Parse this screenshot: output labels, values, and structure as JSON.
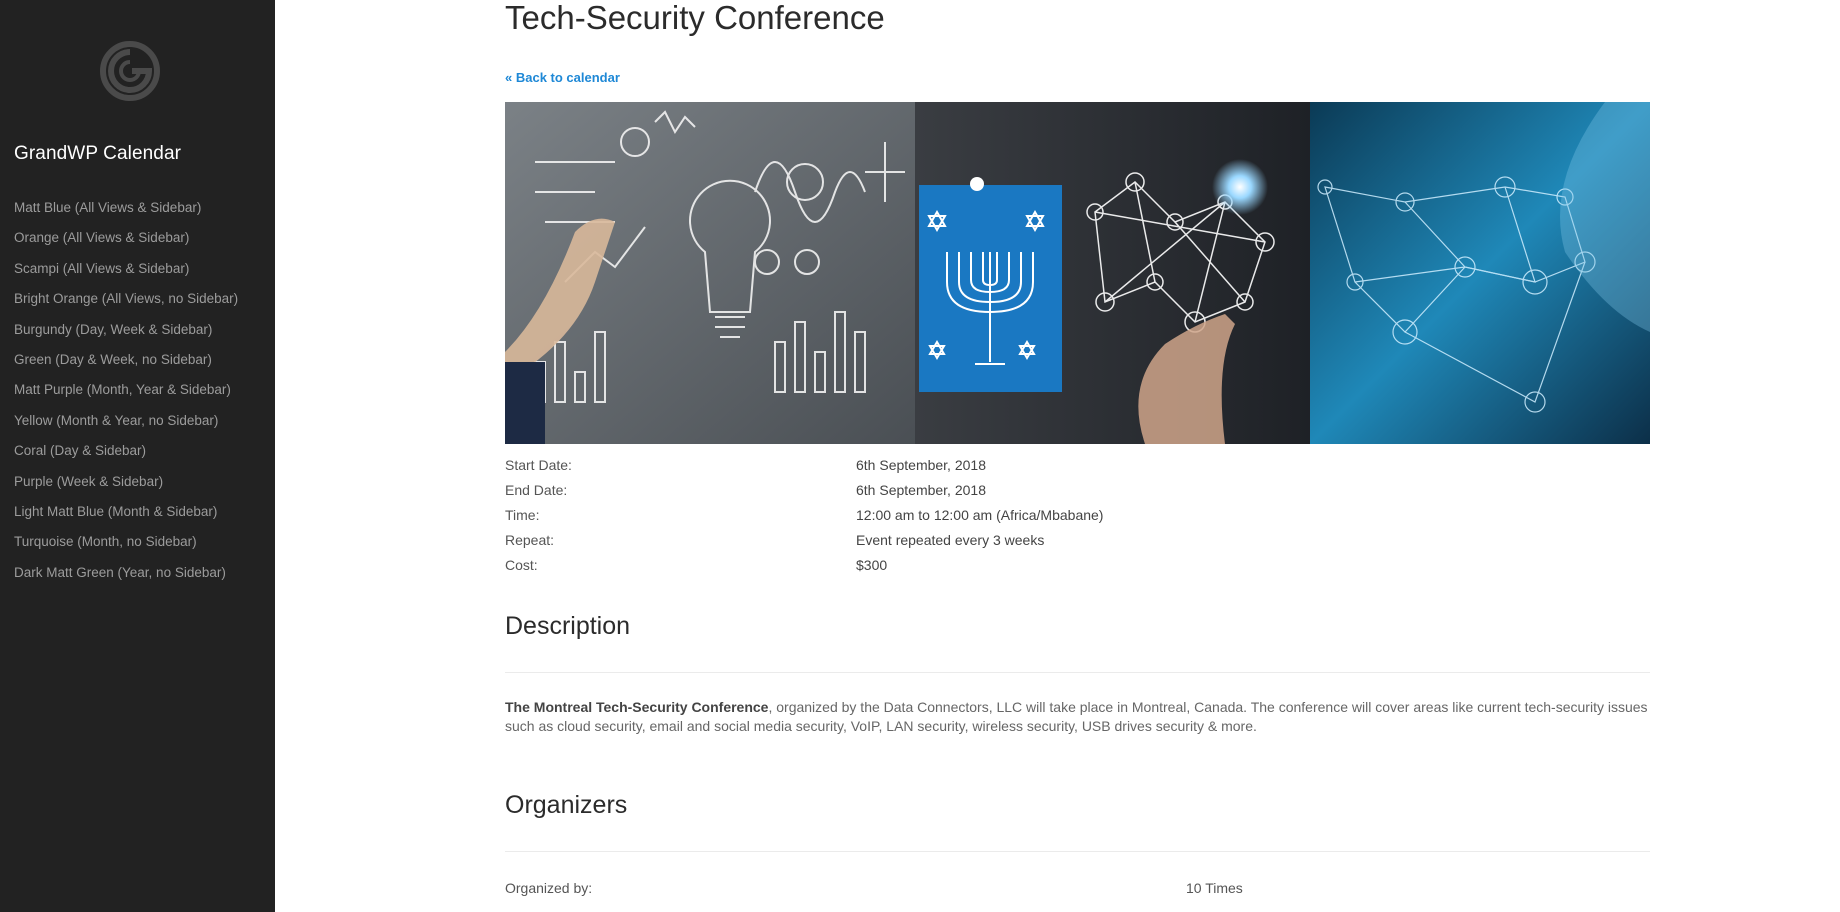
{
  "sidebar": {
    "brand": "GrandWP Calendar",
    "logo_icon": "grandwp-logo-icon",
    "items": [
      {
        "label": "Matt Blue (All Views & Sidebar)"
      },
      {
        "label": "Orange (All Views & Sidebar)"
      },
      {
        "label": "Scampi (All Views & Sidebar)"
      },
      {
        "label": "Bright Orange (All Views, no Sidebar)"
      },
      {
        "label": "Burgundy (Day, Week & Sidebar)"
      },
      {
        "label": "Green (Day & Week, no Sidebar)"
      },
      {
        "label": "Matt Purple (Month, Year & Sidebar)"
      },
      {
        "label": "Yellow (Month & Year, no Sidebar)"
      },
      {
        "label": "Coral (Day & Sidebar)"
      },
      {
        "label": "Purple (Week & Sidebar)"
      },
      {
        "label": "Light Matt Blue (Month & Sidebar)"
      },
      {
        "label": "Turquoise (Month, no Sidebar)"
      },
      {
        "label": "Dark Matt Green (Year, no Sidebar)"
      }
    ]
  },
  "event": {
    "title": "Tech-Security Conference",
    "back_link": "« Back to calendar",
    "details": [
      {
        "label": "Start Date:",
        "value": "6th September, 2018"
      },
      {
        "label": "End Date:",
        "value": "6th September, 2018"
      },
      {
        "label": "Time:",
        "value": "12:00 am to 12:00 am (Africa/Mbabane)"
      },
      {
        "label": "Repeat:",
        "value": "Event repeated every 3 weeks"
      },
      {
        "label": "Cost:",
        "value": "$300"
      }
    ],
    "description_heading": "Description",
    "description_bold": "The Montreal Tech-Security Conference",
    "description_rest": ", organized by the Data Connectors, LLC will take place in Montreal, Canada. The conference will cover areas like current tech-security issues such as cloud security, email and social media security, VoIP, LAN security, wireless security, USB drives security & more.",
    "organizers_heading": "Organizers",
    "organized_by_label": "Organized by:",
    "organized_count": "10 Times"
  },
  "colors": {
    "sidebar_bg": "#222222",
    "link_blue": "#1e88d6",
    "banner_blue": "#1a78c2"
  }
}
